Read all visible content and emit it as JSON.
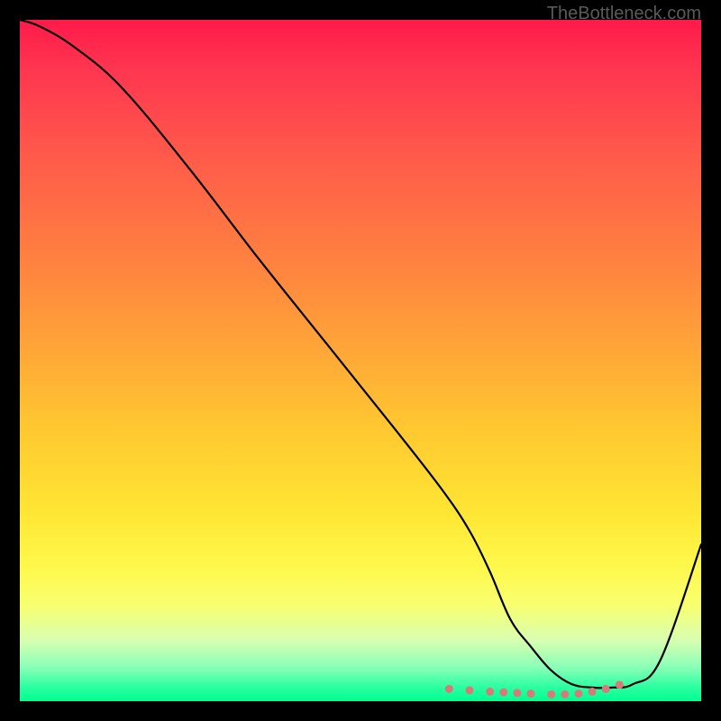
{
  "watermark": "TheBottleneck.com",
  "chart_data": {
    "type": "line",
    "title": "",
    "xlabel": "",
    "ylabel": "",
    "xlim": [
      0,
      100
    ],
    "ylim": [
      0,
      100
    ],
    "x": [
      0,
      3,
      8,
      15,
      25,
      35,
      45,
      55,
      62,
      66,
      69,
      72,
      75,
      78,
      81,
      84,
      87,
      90,
      94,
      100
    ],
    "values": [
      100,
      99,
      96,
      90,
      78,
      65,
      52.5,
      40,
      31,
      25,
      19,
      12,
      8,
      4.5,
      2.5,
      2,
      2,
      2.5,
      6,
      23
    ],
    "markers": {
      "x": [
        63,
        66,
        69,
        71,
        73,
        75,
        78,
        80,
        82,
        84,
        86,
        88
      ],
      "y": [
        1.8,
        1.6,
        1.4,
        1.3,
        1.2,
        1.1,
        1.0,
        1.0,
        1.1,
        1.4,
        1.8,
        2.4
      ],
      "color": "#d87a7a"
    },
    "gradient_stops": [
      {
        "pos": 0,
        "color": "#ff1a4a"
      },
      {
        "pos": 20,
        "color": "#ff5a4a"
      },
      {
        "pos": 48,
        "color": "#ffa538"
      },
      {
        "pos": 72,
        "color": "#ffe533"
      },
      {
        "pos": 91,
        "color": "#d8ffb0"
      },
      {
        "pos": 100,
        "color": "#00ff90"
      }
    ]
  }
}
